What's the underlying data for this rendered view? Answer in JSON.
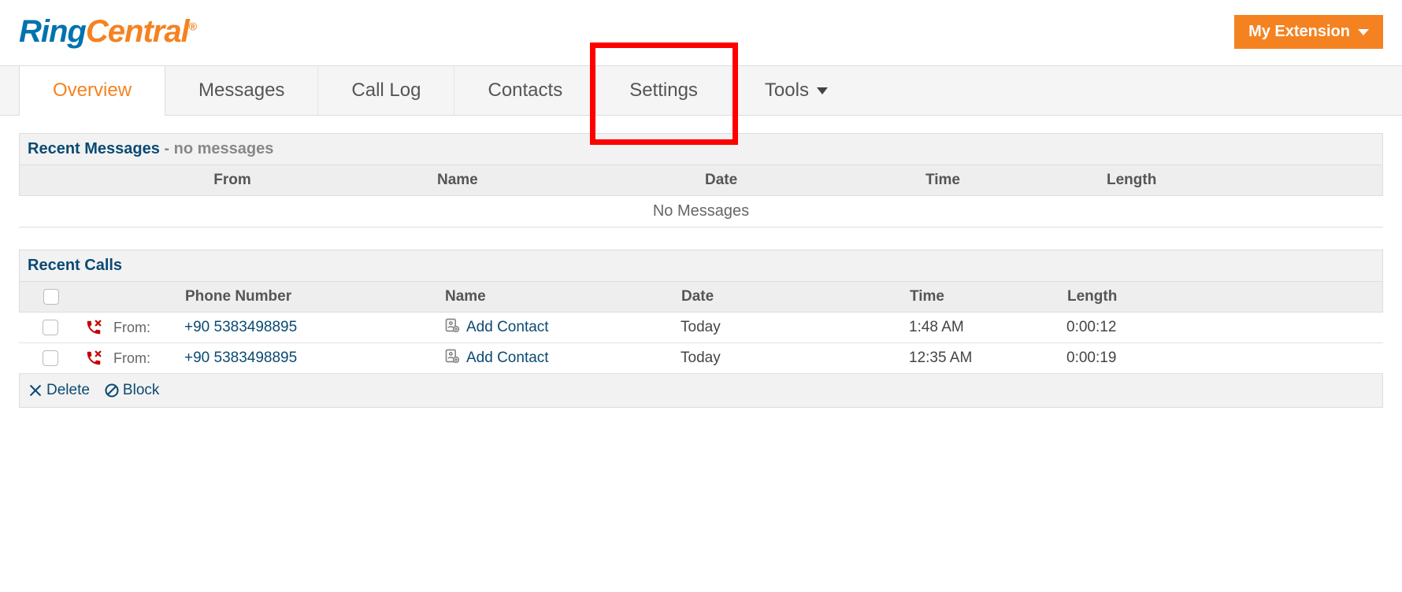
{
  "header": {
    "logo_part1": "Ring",
    "logo_part2": "Central",
    "logo_reg": "®",
    "my_extension_label": "My Extension"
  },
  "nav": {
    "tabs": [
      {
        "label": "Overview",
        "active": true
      },
      {
        "label": "Messages"
      },
      {
        "label": "Call Log"
      },
      {
        "label": "Contacts"
      },
      {
        "label": "Settings",
        "highlighted": true
      },
      {
        "label": "Tools",
        "dropdown": true
      }
    ]
  },
  "recent_messages": {
    "title": "Recent Messages",
    "subtitle": " - no messages",
    "columns": {
      "from": "From",
      "name": "Name",
      "date": "Date",
      "time": "Time",
      "length": "Length"
    },
    "empty_text": "No Messages"
  },
  "recent_calls": {
    "title": "Recent Calls",
    "columns": {
      "phone": "Phone Number",
      "name": "Name",
      "date": "Date",
      "time": "Time",
      "length": "Length"
    },
    "from_label": "From:",
    "add_contact_label": "Add Contact",
    "rows": [
      {
        "phone": "+90 5383498895",
        "date": "Today",
        "time": "1:48 AM",
        "length": "0:00:12"
      },
      {
        "phone": "+90 5383498895",
        "date": "Today",
        "time": "12:35 AM",
        "length": "0:00:19"
      }
    ],
    "actions": {
      "delete": "Delete",
      "block": "Block"
    }
  }
}
